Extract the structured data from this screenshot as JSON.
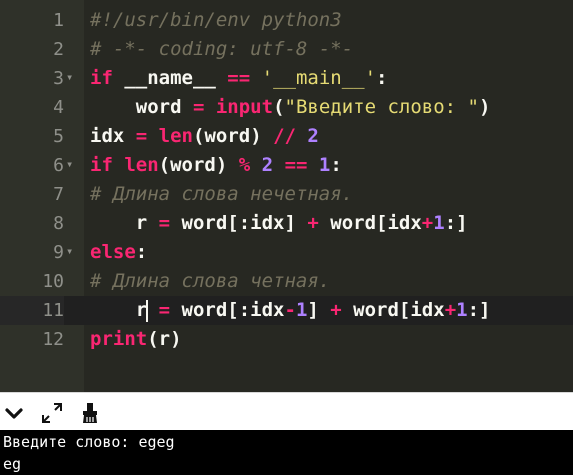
{
  "editor": {
    "colors": {
      "background": "#272822",
      "gutter": "#2f3129",
      "comment": "#75715e",
      "keyword": "#f92672",
      "string": "#e6db74",
      "number": "#ae81ff",
      "text": "#f8f8f2",
      "line_number": "#8f908a"
    },
    "active_line": 11,
    "lines": [
      {
        "n": "1",
        "fold": "",
        "tokens": [
          {
            "t": "#!/usr/bin/env python3",
            "c": "comment"
          }
        ]
      },
      {
        "n": "2",
        "fold": "",
        "tokens": [
          {
            "t": "# -*- coding: utf-8 -*-",
            "c": "comment"
          }
        ]
      },
      {
        "n": "3",
        "fold": "▾",
        "tokens": [
          {
            "t": "if",
            "c": "keyword"
          },
          {
            "t": " __name__ ",
            "c": "text"
          },
          {
            "t": "==",
            "c": "keyword"
          },
          {
            "t": " ",
            "c": "text"
          },
          {
            "t": "'__main__'",
            "c": "string"
          },
          {
            "t": ":",
            "c": "text"
          }
        ]
      },
      {
        "n": "4",
        "fold": "",
        "tokens": [
          {
            "t": "    word ",
            "c": "text"
          },
          {
            "t": "=",
            "c": "keyword"
          },
          {
            "t": " ",
            "c": "text"
          },
          {
            "t": "input",
            "c": "keyword"
          },
          {
            "t": "(",
            "c": "text"
          },
          {
            "t": "\"Введите слово: \"",
            "c": "string"
          },
          {
            "t": ")",
            "c": "text"
          }
        ]
      },
      {
        "n": "5",
        "fold": "",
        "tokens": [
          {
            "t": "idx ",
            "c": "text"
          },
          {
            "t": "=",
            "c": "keyword"
          },
          {
            "t": " ",
            "c": "text"
          },
          {
            "t": "len",
            "c": "keyword"
          },
          {
            "t": "(word) ",
            "c": "text"
          },
          {
            "t": "//",
            "c": "keyword"
          },
          {
            "t": " ",
            "c": "text"
          },
          {
            "t": "2",
            "c": "number"
          }
        ]
      },
      {
        "n": "6",
        "fold": "▾",
        "tokens": [
          {
            "t": "if",
            "c": "keyword"
          },
          {
            "t": " ",
            "c": "text"
          },
          {
            "t": "len",
            "c": "keyword"
          },
          {
            "t": "(word) ",
            "c": "text"
          },
          {
            "t": "%",
            "c": "keyword"
          },
          {
            "t": " ",
            "c": "text"
          },
          {
            "t": "2",
            "c": "number"
          },
          {
            "t": " ",
            "c": "text"
          },
          {
            "t": "==",
            "c": "keyword"
          },
          {
            "t": " ",
            "c": "text"
          },
          {
            "t": "1",
            "c": "number"
          },
          {
            "t": ":",
            "c": "text"
          }
        ]
      },
      {
        "n": "7",
        "fold": "",
        "tokens": [
          {
            "t": "# Длина слова нечетная.",
            "c": "comment"
          }
        ]
      },
      {
        "n": "8",
        "fold": "",
        "tokens": [
          {
            "t": "    r ",
            "c": "text"
          },
          {
            "t": "=",
            "c": "keyword"
          },
          {
            "t": " word[:idx] ",
            "c": "text"
          },
          {
            "t": "+",
            "c": "keyword"
          },
          {
            "t": " word[idx",
            "c": "text"
          },
          {
            "t": "+",
            "c": "keyword"
          },
          {
            "t": "1",
            "c": "number"
          },
          {
            "t": ":]",
            "c": "text"
          }
        ]
      },
      {
        "n": "9",
        "fold": "▾",
        "tokens": [
          {
            "t": "else",
            "c": "keyword"
          },
          {
            "t": ":",
            "c": "text"
          }
        ]
      },
      {
        "n": "10",
        "fold": "",
        "tokens": [
          {
            "t": "# Длина слова четная.",
            "c": "comment"
          }
        ]
      },
      {
        "n": "11",
        "fold": "",
        "tokens": [
          {
            "t": "    r ",
            "c": "text"
          },
          {
            "t": "=",
            "c": "keyword"
          },
          {
            "t": " word[:idx",
            "c": "text"
          },
          {
            "t": "-",
            "c": "keyword"
          },
          {
            "t": "1",
            "c": "number"
          },
          {
            "t": "] ",
            "c": "text"
          },
          {
            "t": "+",
            "c": "keyword"
          },
          {
            "t": " word[idx",
            "c": "text"
          },
          {
            "t": "+",
            "c": "keyword"
          },
          {
            "t": "1",
            "c": "number"
          },
          {
            "t": ":]",
            "c": "text"
          }
        ]
      },
      {
        "n": "12",
        "fold": "",
        "tokens": [
          {
            "t": "print",
            "c": "keyword"
          },
          {
            "t": "(r)",
            "c": "text"
          }
        ]
      }
    ]
  },
  "toolbar": {
    "icons": [
      "chevron-down-icon",
      "expand-icon",
      "clear-console-icon"
    ]
  },
  "terminal": {
    "line1": "Введите слово: egeg",
    "line2": "eg"
  }
}
